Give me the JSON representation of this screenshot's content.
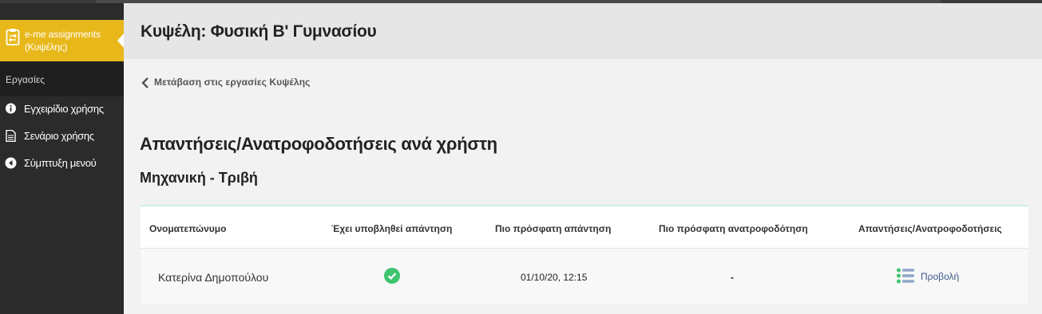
{
  "app": {
    "brand_label": "e-me assignments (Κυψέλης)",
    "accent": "#e8b81b"
  },
  "sidebar": {
    "section_title": "Εργασίες",
    "items": [
      {
        "label": "Εγχειρίδιο χρήσης",
        "icon": "info-pin-icon"
      },
      {
        "label": "Σενάριο χρήσης",
        "icon": "document-icon"
      },
      {
        "label": "Σύμπτυξη μενού",
        "icon": "collapse-left-icon"
      }
    ]
  },
  "header": {
    "title": "Κυψέλη: Φυσική Β' Γυμνασίου"
  },
  "main": {
    "back_link": "Μετάβαση στις εργασίες Κυψέλης",
    "page_title": "Απαντήσεις/Ανατροφοδοτήσεις ανά χρήστη",
    "subtitle": "Μηχανική - Τριβή"
  },
  "table": {
    "headers": [
      "Ονοματεπώνυμο",
      "Έχει υποβληθεί απάντηση",
      "Πιο πρόσφατη απάντηση",
      "Πιο πρόσφατη ανατροφοδότηση",
      "Απαντήσεις/Ανατροφοδοτήσεις"
    ],
    "rows": [
      {
        "name": "Κατερίνα Δημοπούλου",
        "submitted_icon": "check-circle-icon",
        "latest_answer": "01/10/20, 12:15",
        "latest_feedback": "-",
        "view_label": "Προβολή"
      }
    ]
  }
}
